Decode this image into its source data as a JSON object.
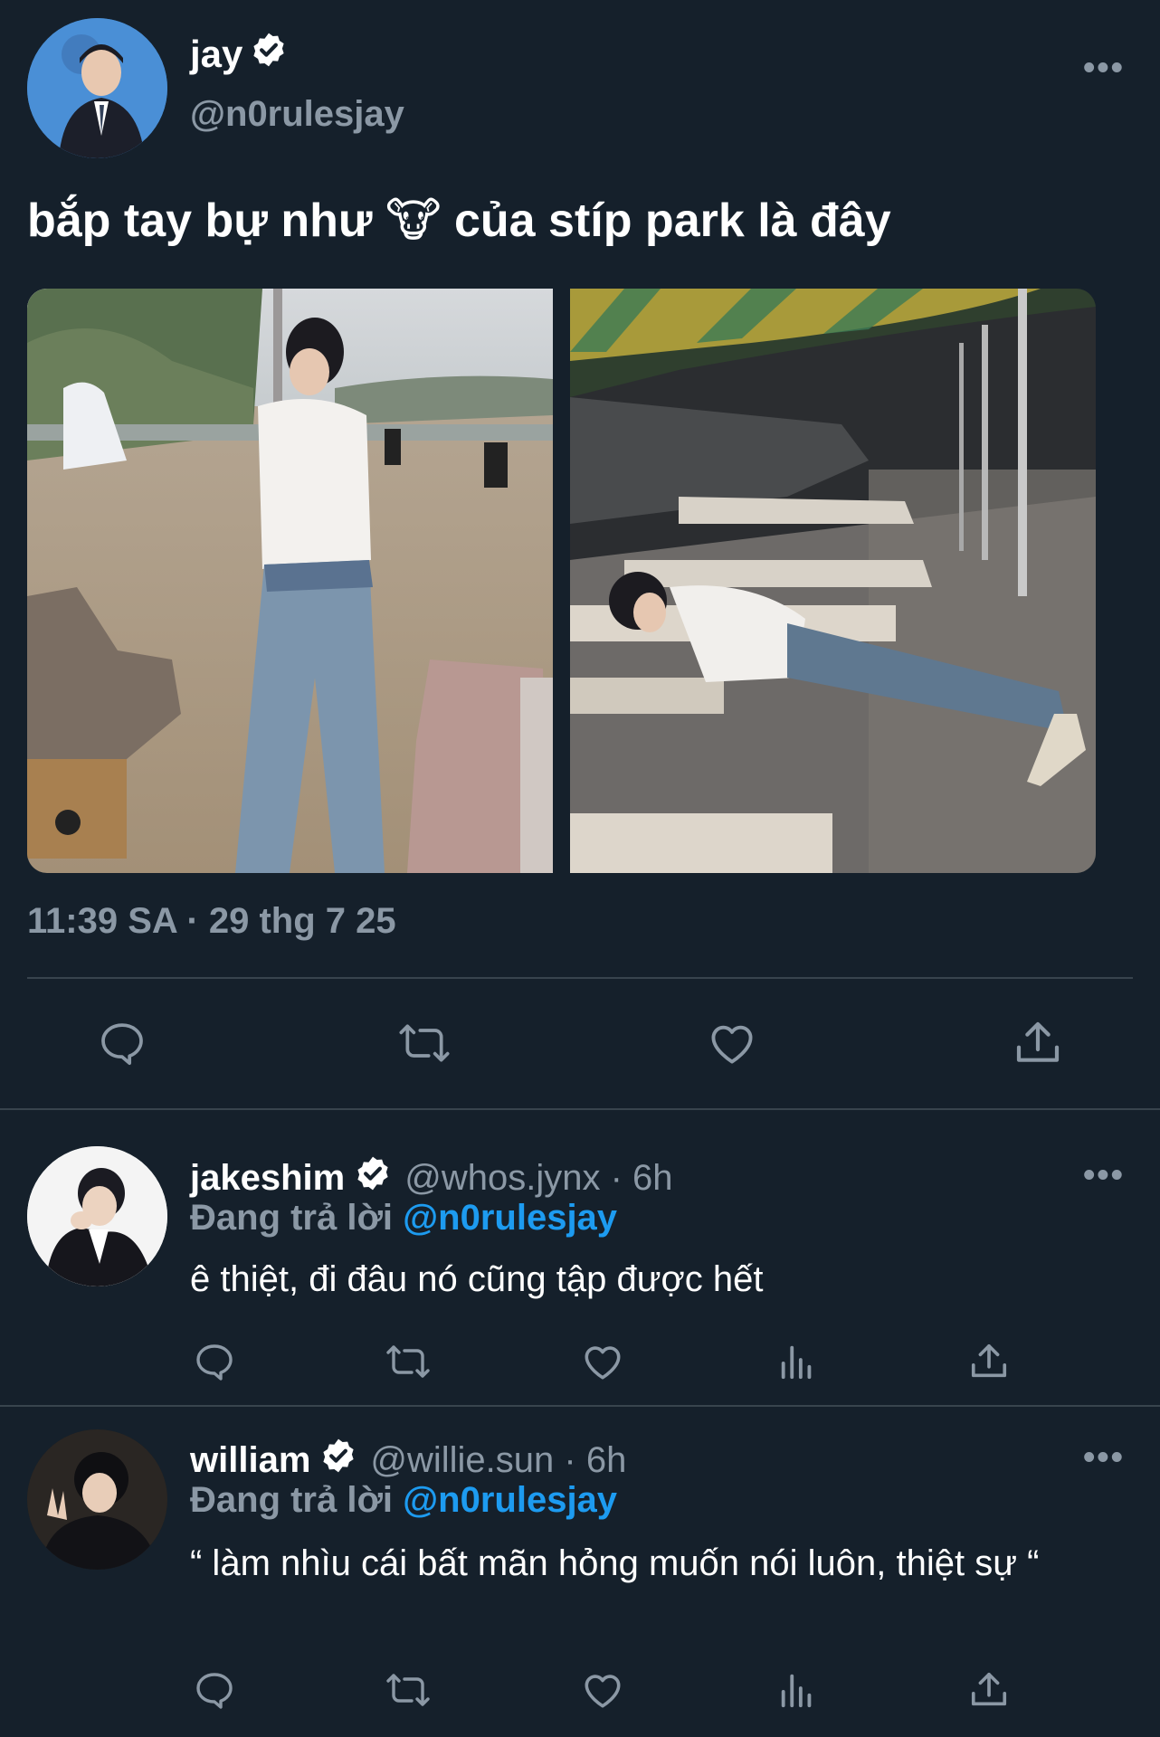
{
  "main_tweet": {
    "display_name": "jay",
    "handle": "@n0rulesjay",
    "text": "bắp tay bự như 🐮 của stíp park là đây",
    "timestamp": "11:39 SA · 29 thg 7 25",
    "more_label": "•••"
  },
  "replies": [
    {
      "display_name": "jakeshim",
      "handle_time": "@whos.jynx · 6h",
      "replying_prefix": "Đang trả lời",
      "replying_to": "@n0rulesjay",
      "text": "ê thiệt, đi đâu nó cũng tập được hết",
      "more_label": "•••"
    },
    {
      "display_name": "william",
      "handle_time": "@willie.sun · 6h",
      "replying_prefix": "Đang trả lời",
      "replying_to": "@n0rulesjay",
      "text": "“ làm nhìu cái bất mãn hỏng muốn nói luôn, thiệt sự “",
      "more_label": "•••"
    }
  ],
  "icons": [
    "reply-icon",
    "retweet-icon",
    "like-icon",
    "views-icon",
    "share-icon",
    "verified-icon",
    "more-icon"
  ],
  "colors": {
    "background": "#15202b",
    "link": "#1d9bf0",
    "muted": "#8b98a5",
    "divider": "#38444d"
  }
}
